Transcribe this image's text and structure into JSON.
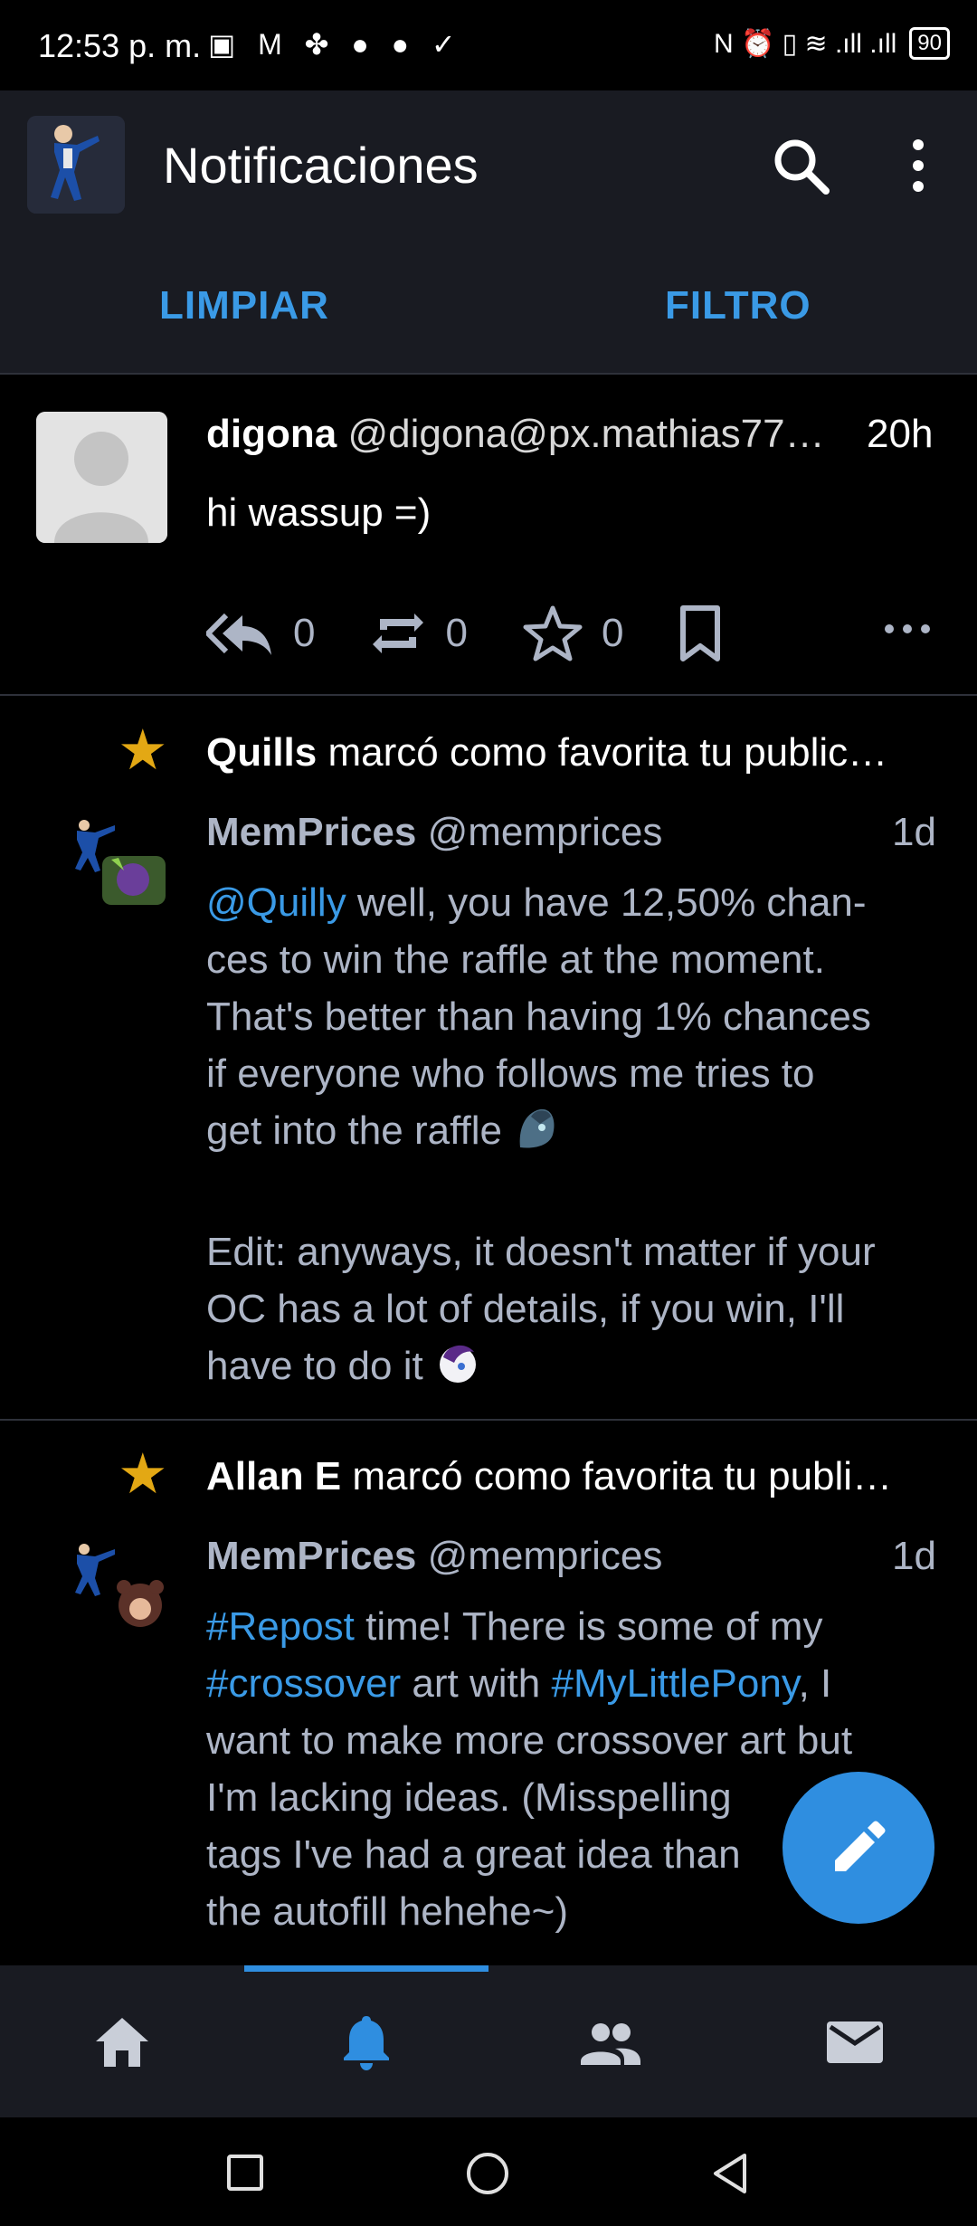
{
  "status_bar": {
    "time": "12:53 p. m.",
    "left_icons": "▣ M ✤ ● ●  ✓",
    "right_icons": "N ⏰ ▯ ≋ .ıll .ıll",
    "battery": "90"
  },
  "app_bar": {
    "title": "Notificaciones",
    "search_icon": "search-icon",
    "more_icon": "more-vert-icon"
  },
  "tabs": {
    "clear_label": "LIMPIAR",
    "filter_label": "FILTRO"
  },
  "notifications": [
    {
      "type": "mention",
      "display_name": "digona",
      "handle": "@digona@px.mathias77…",
      "time": "20h",
      "text": "hi wassup =)",
      "replies": "0",
      "boosts": "0",
      "favourites": "0"
    },
    {
      "type": "favourite",
      "actor": "Quills",
      "action": "marcó como favorita tu public…",
      "display_name": "MemPrices",
      "handle": "@memprices",
      "time": "1d",
      "lines": [
        {
          "mention": "@Quilly",
          "rest": " well, you have 12,50% chan-"
        },
        {
          "text": "ces to win the raffle at the moment."
        },
        {
          "text": "That's better than having 1% chances"
        },
        {
          "text": "if everyone who follows me tries to"
        },
        {
          "text": "get into the raffle"
        },
        {
          "text": "Edit: anyways, it doesn't matter if your"
        },
        {
          "text": "OC has a lot of details, if you win, I'll"
        },
        {
          "text": "have to do it"
        }
      ]
    },
    {
      "type": "favourite",
      "actor": "Allan E",
      "action": "marcó como favorita tu publi…",
      "display_name": "MemPrices",
      "handle": "@memprices",
      "time": "1d",
      "line1_tag": "#Repost",
      "line1_rest": " time! There is some of my",
      "line2_tag1": "#crossover",
      "line2_mid": " art with ",
      "line2_tag2": "#MyLittlePony",
      "line2_end": ", I",
      "line3": "want to make more crossover art but",
      "line4": "I'm lacking ideas. (Misspelling",
      "line5": "tags I've had a great idea than",
      "line6": "the autofill hehehe~)"
    }
  ],
  "bottom_nav": {
    "items": [
      "home-icon",
      "notifications-icon",
      "people-icon",
      "mail-icon"
    ],
    "active": "notifications-icon"
  },
  "colors": {
    "accent": "#3a9ae6",
    "star": "#e3a814",
    "bar_bg": "#191b22"
  }
}
